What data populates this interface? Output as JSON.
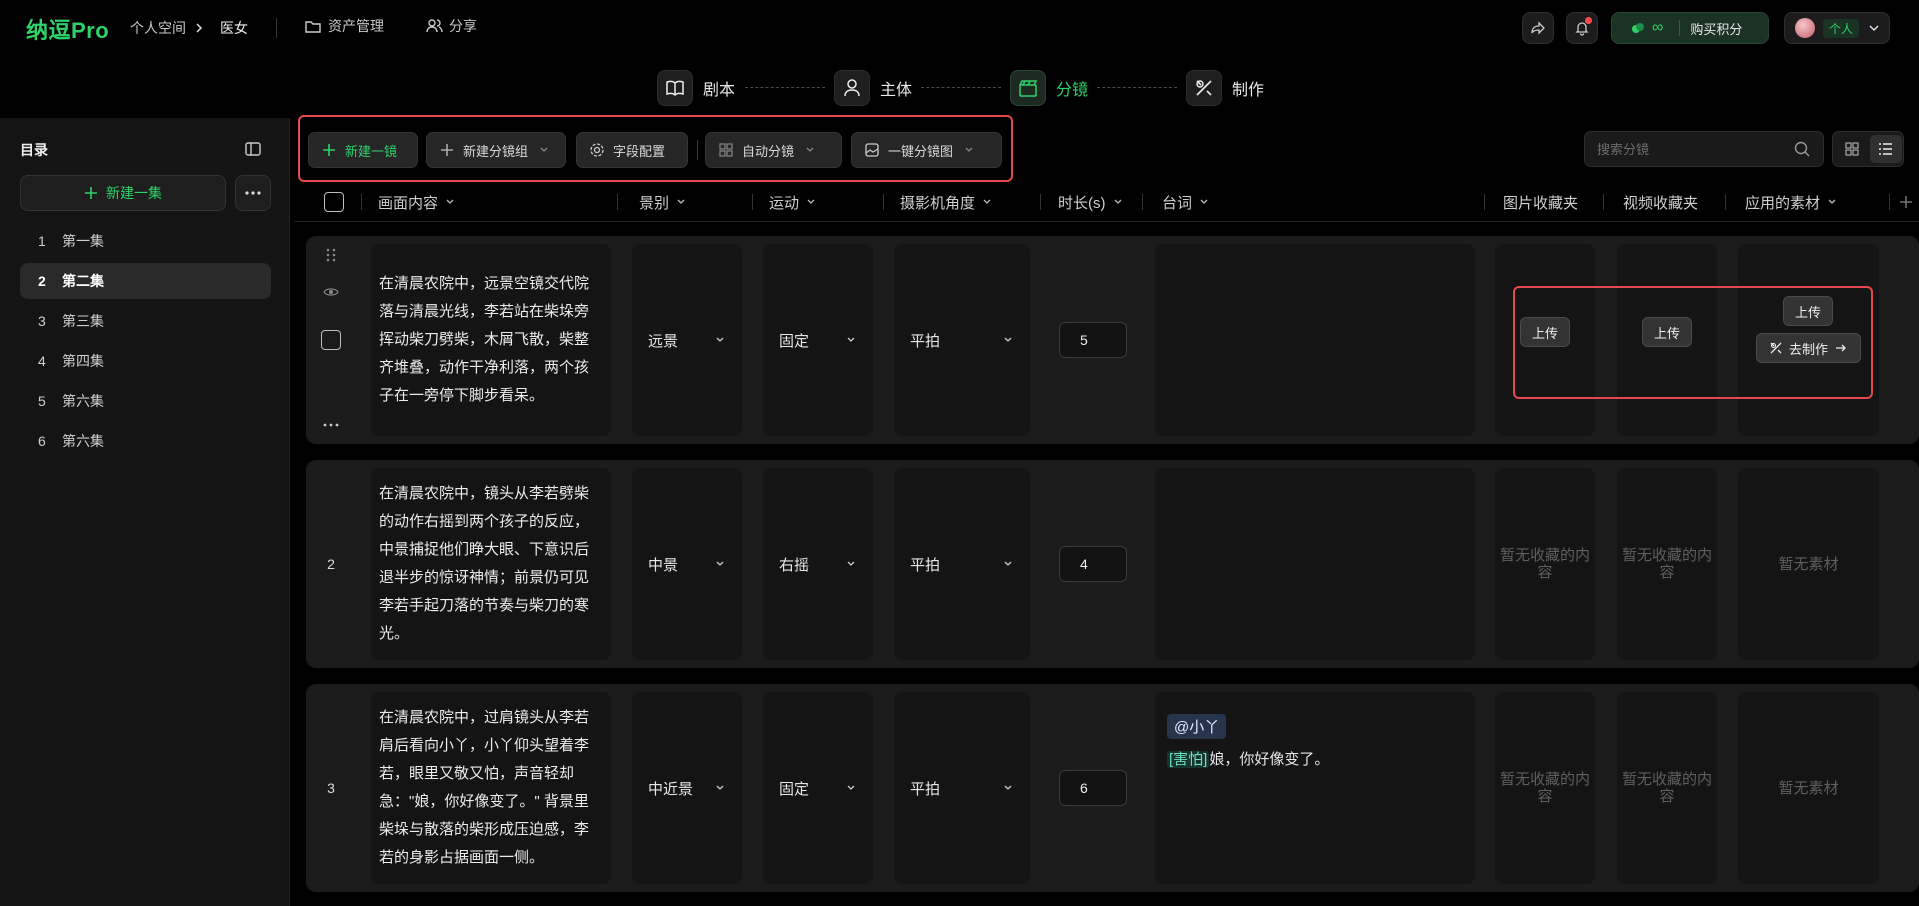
{
  "app": {
    "logo": "纳逗Pro",
    "breadcrumb": [
      "个人空间",
      "医女"
    ],
    "nav": [
      "资产管理",
      "分享"
    ],
    "points_label": "购买积分",
    "points_value": "∞",
    "user_tag": "个人"
  },
  "steps": [
    {
      "label": "剧本",
      "icon": "book-icon"
    },
    {
      "label": "主体",
      "icon": "person-icon"
    },
    {
      "label": "分镜",
      "icon": "clapperboard-icon",
      "active": true
    },
    {
      "label": "制作",
      "icon": "tools-icon"
    }
  ],
  "sidebar": {
    "title": "目录",
    "new_episode": "新建一集",
    "episodes": [
      {
        "num": "1",
        "label": "第一集"
      },
      {
        "num": "2",
        "label": "第二集",
        "active": true
      },
      {
        "num": "3",
        "label": "第三集"
      },
      {
        "num": "4",
        "label": "第四集"
      },
      {
        "num": "5",
        "label": "第六集"
      },
      {
        "num": "6",
        "label": "第六集"
      }
    ]
  },
  "toolbar": {
    "new_shot": "新建一镜",
    "new_group": "新建分镜组",
    "field_config": "字段配置",
    "auto_split": "自动分镜",
    "one_click": "一键分镜图",
    "search_placeholder": "搜索分镜"
  },
  "columns": {
    "content": "画面内容",
    "shot_size": "景别",
    "motion": "运动",
    "angle": "摄影机角度",
    "duration": "时长(s)",
    "dialogue": "台词",
    "image_fav": "图片收藏夹",
    "video_fav": "视频收藏夹",
    "applied": "应用的素材"
  },
  "rows": [
    {
      "num": "",
      "content": "在清晨农院中，远景空镜交代院落与清晨光线，李若站在柴垛旁挥动柴刀劈柴，木屑飞散，柴整齐堆叠，动作干净利落，两个孩子在一旁停下脚步看呆。",
      "shot_size": "远景",
      "motion": "固定",
      "angle": "平拍",
      "duration": "5",
      "upload": "上传",
      "make": "去制作"
    },
    {
      "num": "2",
      "content": "在清晨农院中，镜头从李若劈柴的动作右摇到两个孩子的反应，中景捕捉他们睁大眼、下意识后退半步的惊讶神情；前景仍可见李若手起刀落的节奏与柴刀的寒光。",
      "shot_size": "中景",
      "motion": "右摇",
      "angle": "平拍",
      "duration": "4",
      "image_empty": "暂无收藏的内容",
      "video_empty": "暂无收藏的内容",
      "applied_empty": "暂无素材"
    },
    {
      "num": "3",
      "content": "在清晨农院中，过肩镜头从李若肩后看向小丫，小丫仰头望着李若，眼里又敬又怕，声音轻却急：\"娘，你好像变了。\" 背景里柴垛与散落的柴形成压迫感，李若的身影占据画面一侧。",
      "shot_size": "中近景",
      "motion": "固定",
      "angle": "平拍",
      "duration": "6",
      "mention": "@小丫",
      "emotion": "[害怕]",
      "dialogue": "娘，你好像变了。",
      "image_empty": "暂无收藏的内容",
      "video_empty": "暂无收藏的内容",
      "applied_empty": "暂无素材"
    }
  ]
}
